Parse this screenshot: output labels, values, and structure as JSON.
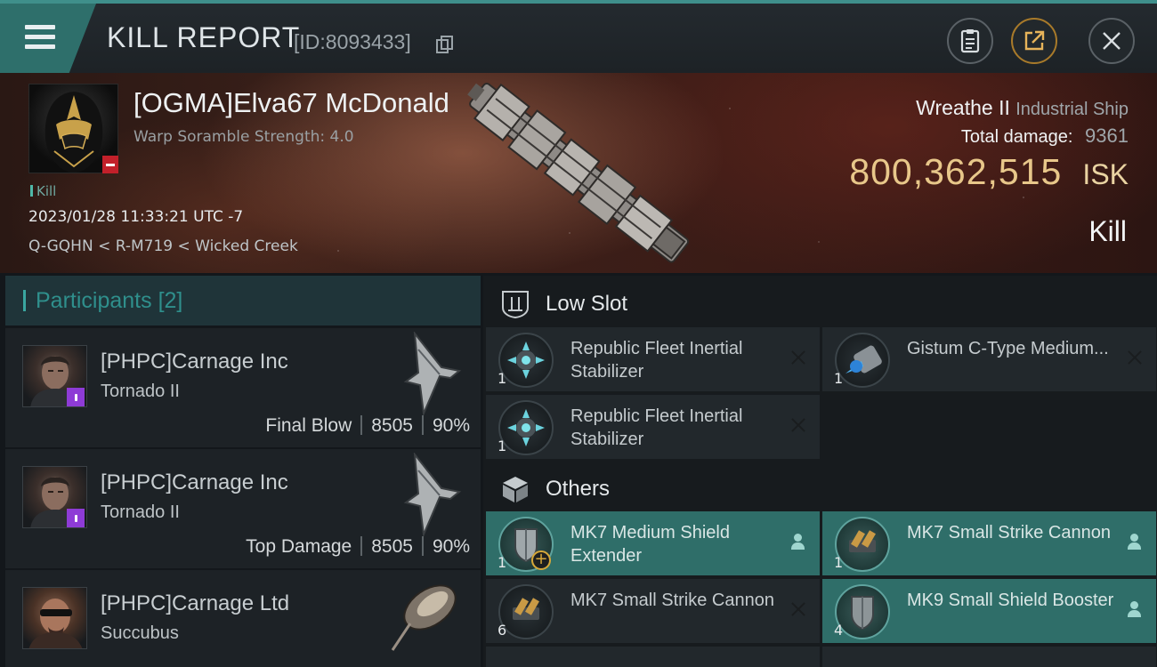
{
  "header": {
    "title": "KILL REPORT",
    "report_id": "[ID:8093433]",
    "icons": [
      "menu-icon",
      "copy-icon",
      "clipboard-icon",
      "share-icon",
      "close-icon"
    ]
  },
  "victim": {
    "name": "[OGMA]Elva67 McDonald",
    "scramble": "Warp Soramble Strength: 4.0",
    "kill_tag": "Kill",
    "timestamp": "2023/01/28 11:33:21 UTC -7",
    "location": "Q-GQHN < R-M719 < Wicked Creek",
    "ship": "Wreathe II",
    "ship_class": "Industrial Ship",
    "total_damage_label": "Total damage:",
    "total_damage": "9361",
    "isk_value": "800,362,515",
    "isk_unit": "ISK",
    "result": "Kill"
  },
  "participants": {
    "label": "Participants",
    "count": "[2]",
    "rows": [
      {
        "name": "[PHPC]Carnage Inc",
        "ship": "Tornado II",
        "role": "Final Blow",
        "damage": "8505",
        "percent": "90%"
      },
      {
        "name": "[PHPC]Carnage Inc",
        "ship": "Tornado II",
        "role": "Top Damage",
        "damage": "8505",
        "percent": "90%"
      },
      {
        "name": "[PHPC]Carnage Ltd",
        "ship": "Succubus",
        "role": "",
        "damage": "",
        "percent": ""
      }
    ]
  },
  "low_slot": {
    "label": "Low Slot",
    "items": [
      {
        "qty": "1",
        "name": "Republic Fleet Inertial Stabilizer",
        "status": "destroyed"
      },
      {
        "qty": "1",
        "name": "Gistum C-Type Medium...",
        "status": "destroyed"
      },
      {
        "qty": "1",
        "name": "Republic Fleet Inertial Stabilizer",
        "status": "destroyed"
      }
    ]
  },
  "others": {
    "label": "Others",
    "items": [
      {
        "qty": "1",
        "name": "MK7 Medium Shield Extender",
        "status": "dropped"
      },
      {
        "qty": "1",
        "name": "MK7 Small Strike Cannon",
        "status": "dropped"
      },
      {
        "qty": "6",
        "name": "MK7 Small Strike Cannon",
        "status": "destroyed"
      },
      {
        "qty": "4",
        "name": "MK9 Small Shield Booster",
        "status": "dropped"
      }
    ]
  },
  "colors": {
    "accent": "#2f6e69",
    "isk": "#e8c78a",
    "purple_badge": "#8e3bd6",
    "red_badge": "#c2202a"
  }
}
